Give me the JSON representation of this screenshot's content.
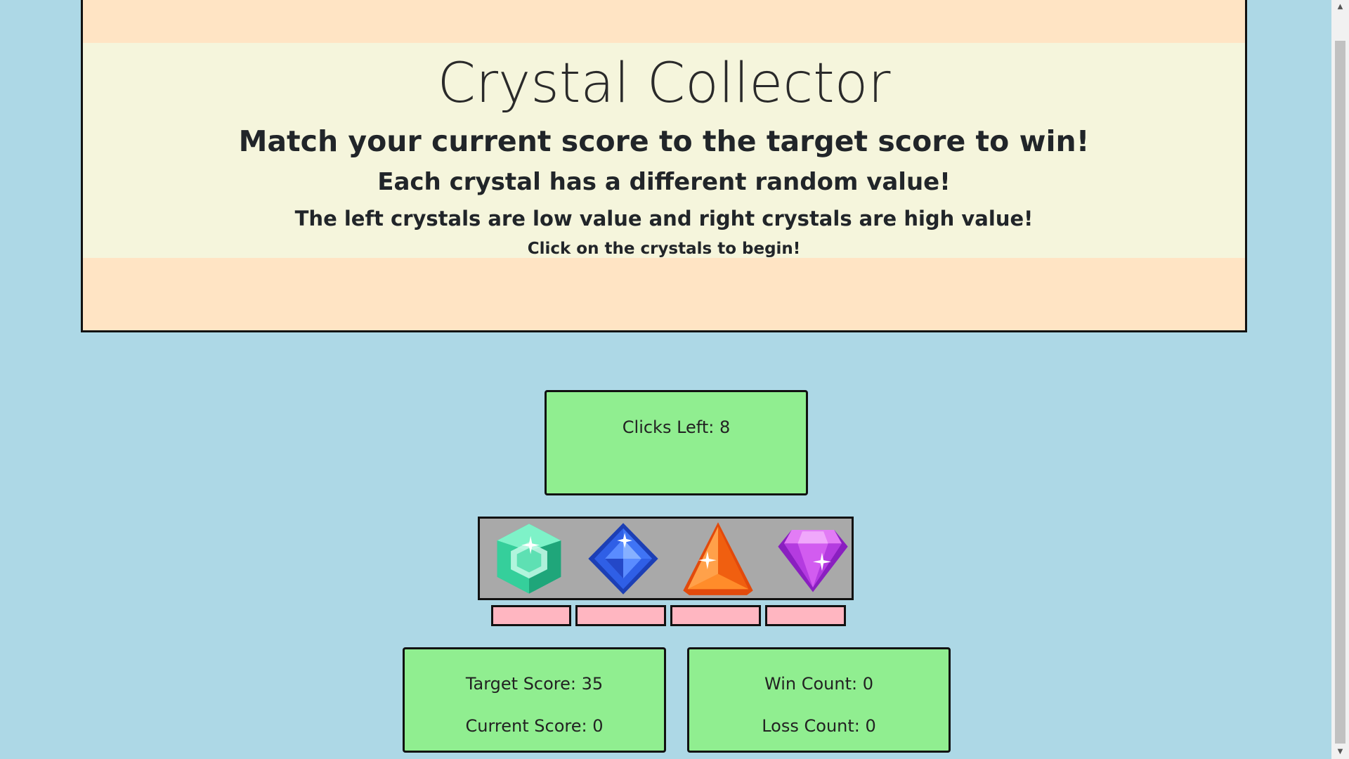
{
  "header": {
    "title": "Crystal Collector",
    "line1": "Match your current score to the target score to win!",
    "line2": "Each crystal has a different random value!",
    "line3": "The left crystals are low value and right crystals are high value!",
    "line4": "Click on the crystals to begin!"
  },
  "game": {
    "clicks_left": "Clicks Left: 8",
    "target_score": "Target Score: 35",
    "current_score": "Current Score: 0",
    "win_count": "Win Count: 0",
    "loss_count": "Loss Count: 0"
  },
  "crystals": [
    {
      "name": "green-crystal",
      "color": "#3fd9a6"
    },
    {
      "name": "blue-crystal",
      "color": "#2a5be8"
    },
    {
      "name": "orange-crystal",
      "color": "#ff7a1a"
    },
    {
      "name": "purple-crystal",
      "color": "#b43be0"
    }
  ],
  "colors": {
    "page_background": "#add8e6",
    "header_background": "#ffe4c4",
    "jumbotron_background": "#f5f5dc",
    "box_background": "#90ee90",
    "value_box_background": "#ffb6c1",
    "tray_background": "#a9a9a9"
  }
}
